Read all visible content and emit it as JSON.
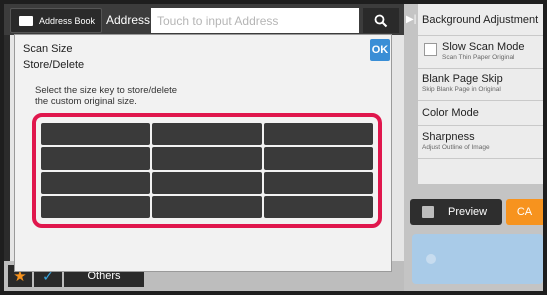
{
  "topbar": {
    "address_book_label": "Address Book",
    "address_label": "Address",
    "address_placeholder": "Touch to input Address"
  },
  "right_panel": {
    "items": [
      {
        "title": "Background Adjustment",
        "sub": ""
      },
      {
        "title": "Slow Scan Mode",
        "sub": "Scan Thin Paper Original"
      },
      {
        "title": "Blank Page Skip",
        "sub": "Skip Blank Page in Original"
      },
      {
        "title": "Color Mode",
        "sub": ""
      },
      {
        "title": "Sharpness",
        "sub": "Adjust Outline of Image"
      }
    ],
    "preview_label": "Preview",
    "ca_label": "CA"
  },
  "bottombar": {
    "others_label": "Others"
  },
  "dialog": {
    "title_line1": "Scan Size",
    "title_line2": "Store/Delete",
    "ok_label": "OK",
    "instruction_line1": "Select the size key to store/delete",
    "instruction_line2": "the custom original size.",
    "size_keys": [
      "",
      "",
      "",
      "",
      "",
      "",
      "",
      "",
      "",
      "",
      "",
      ""
    ]
  },
  "colors": {
    "highlight_frame": "#e0174d",
    "ok_button": "#3a8ed6",
    "ca_button": "#f7931e",
    "star": "#f7931e",
    "check": "#39a7e0",
    "start_button": "#a9cbe8"
  }
}
